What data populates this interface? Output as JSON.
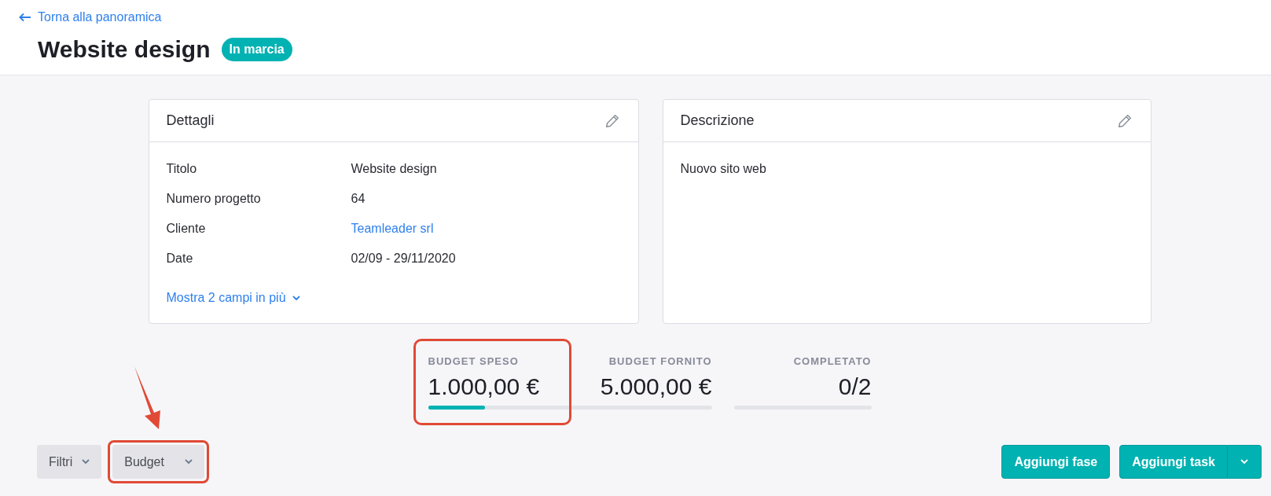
{
  "header": {
    "back_link": "Torna alla panoramica",
    "title": "Website design",
    "status": "In marcia"
  },
  "details": {
    "title": "Dettagli",
    "fields": [
      {
        "label": "Titolo",
        "value": "Website design",
        "kind": "text"
      },
      {
        "label": "Numero progetto",
        "value": "64",
        "kind": "text"
      },
      {
        "label": "Cliente",
        "value": "Teamleader srl",
        "kind": "link"
      },
      {
        "label": "Date",
        "value": "02/09 - 29/11/2020",
        "kind": "text"
      }
    ],
    "more_link": "Mostra 2 campi in più"
  },
  "description": {
    "title": "Descrizione",
    "text": "Nuovo sito web"
  },
  "stats": [
    {
      "label": "BUDGET SPESO",
      "value": "1.000,00 €",
      "level": 0.2,
      "highlighted": true
    },
    {
      "label": "BUDGET FORNITO",
      "value": "5.000,00 €"
    },
    {
      "label": "COMPLETATO",
      "value": "0/2"
    }
  ],
  "filters": [
    {
      "label": "Filtri",
      "highlighted": false
    },
    {
      "label": "Budget",
      "highlighted": true
    }
  ],
  "actions": {
    "add_phase": "Aggiungi fase",
    "add_task": "Aggiungi task"
  }
}
